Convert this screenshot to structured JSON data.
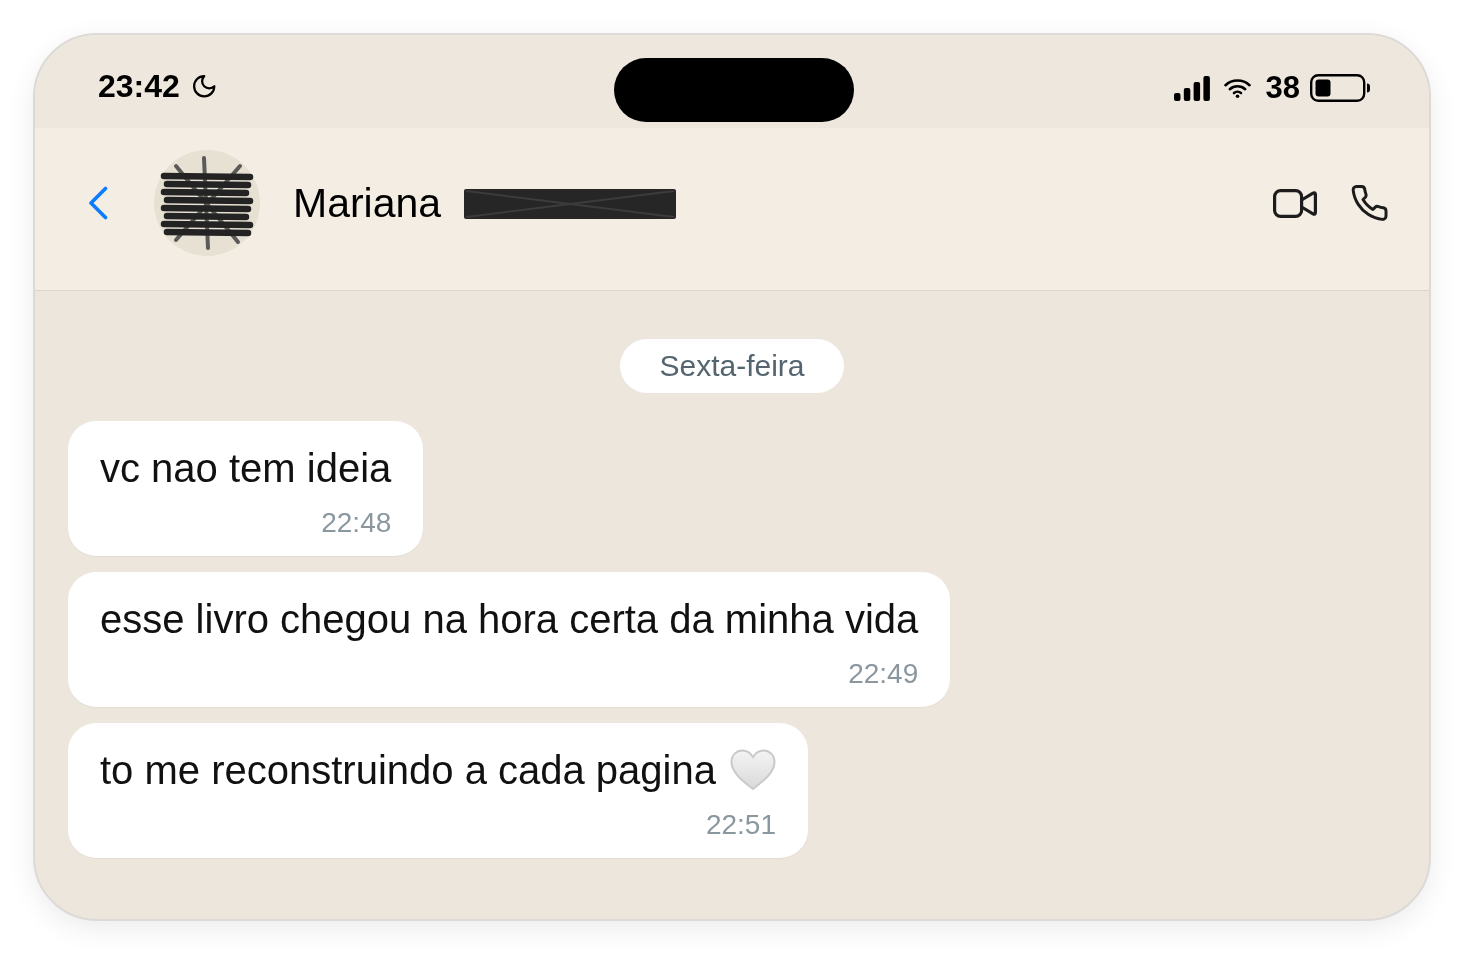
{
  "status_bar": {
    "time": "23:42",
    "sleep_focus": true,
    "battery": "38"
  },
  "header": {
    "contact_name": "Mariana",
    "surname_redacted": true
  },
  "chat": {
    "date_divider": "Sexta-feira",
    "messages": [
      {
        "text": "vc nao tem ideia",
        "time": "22:48",
        "heart": false
      },
      {
        "text": "esse livro chegou na hora certa da minha vida",
        "time": "22:49",
        "heart": false
      },
      {
        "text": "to me reconstruindo a cada pagina",
        "time": "22:51",
        "heart": true
      }
    ]
  }
}
